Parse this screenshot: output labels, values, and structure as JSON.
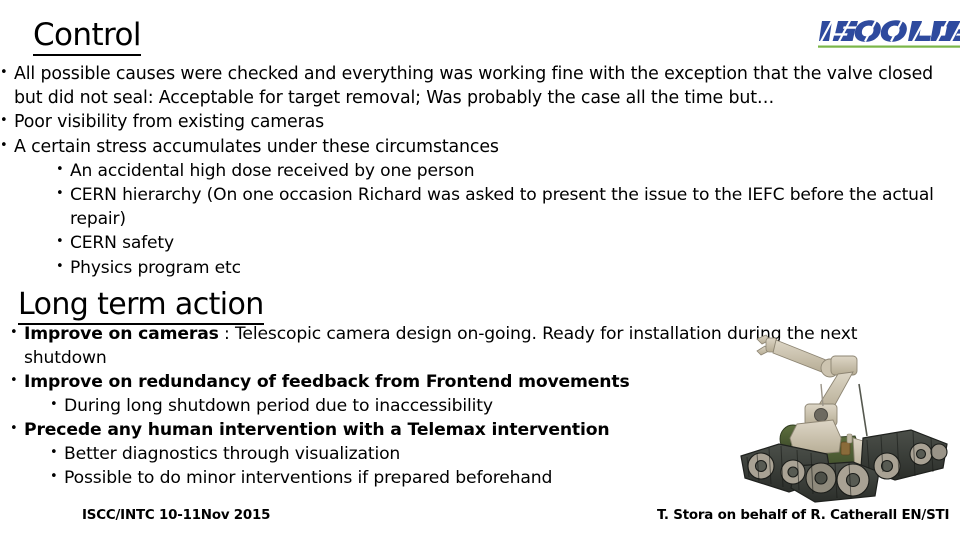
{
  "slide": {
    "logo": {
      "name": "ISOLDE",
      "text": "ISOLDE",
      "text_color": "#2e4a9e",
      "rule_color": "#7ab648"
    },
    "sections": [
      {
        "id": "control",
        "title": "Control"
      },
      {
        "id": "long-term-action",
        "title": "Long term action"
      }
    ],
    "control_bullets": [
      {
        "level": 0,
        "text": "All possible causes were checked and everything was working fine with the exception that the valve closed but did not seal: Acceptable for target removal; Was probably the case all the time but…"
      },
      {
        "level": 0,
        "text": "Poor visibility from existing cameras"
      },
      {
        "level": 0,
        "text": "A certain stress accumulates under these circumstances"
      },
      {
        "level": 1,
        "text": "An accidental high dose received by one person"
      },
      {
        "level": 1,
        "text": "CERN hierarchy (On one occasion Richard was asked to present the issue to the IEFC before the actual repair)"
      },
      {
        "level": 1,
        "text": "CERN safety"
      },
      {
        "level": 1,
        "text": "Physics program etc"
      }
    ],
    "action_bullets": [
      {
        "level": 0,
        "bold_text": "Improve on cameras",
        "text": " : Telescopic camera design on-going.  Ready for installation during the next shutdown"
      },
      {
        "level": 0,
        "bold_text": "Improve on redundancy of feedback from Frontend movements",
        "text": ""
      },
      {
        "level": 1,
        "bold_text": "",
        "text": "During long shutdown period due to inaccessibility"
      },
      {
        "level": 0,
        "bold_text": "Precede any human intervention with a Telemax intervention",
        "text": ""
      },
      {
        "level": 1,
        "bold_text": "",
        "text": "Better diagnostics through visualization"
      },
      {
        "level": 1,
        "bold_text": "",
        "text": "Possible to do minor interventions if prepared beforehand"
      }
    ],
    "robot_image": {
      "name": "telemax-robot-photo",
      "body_color": "#4a5a32",
      "arm_color": "#c9c0ab",
      "track_color": "#3a3d38"
    },
    "footer": {
      "left": "ISCC/INTC 10-11Nov 2015",
      "right": "T. Stora on behalf of R. Catherall EN/STI"
    }
  }
}
